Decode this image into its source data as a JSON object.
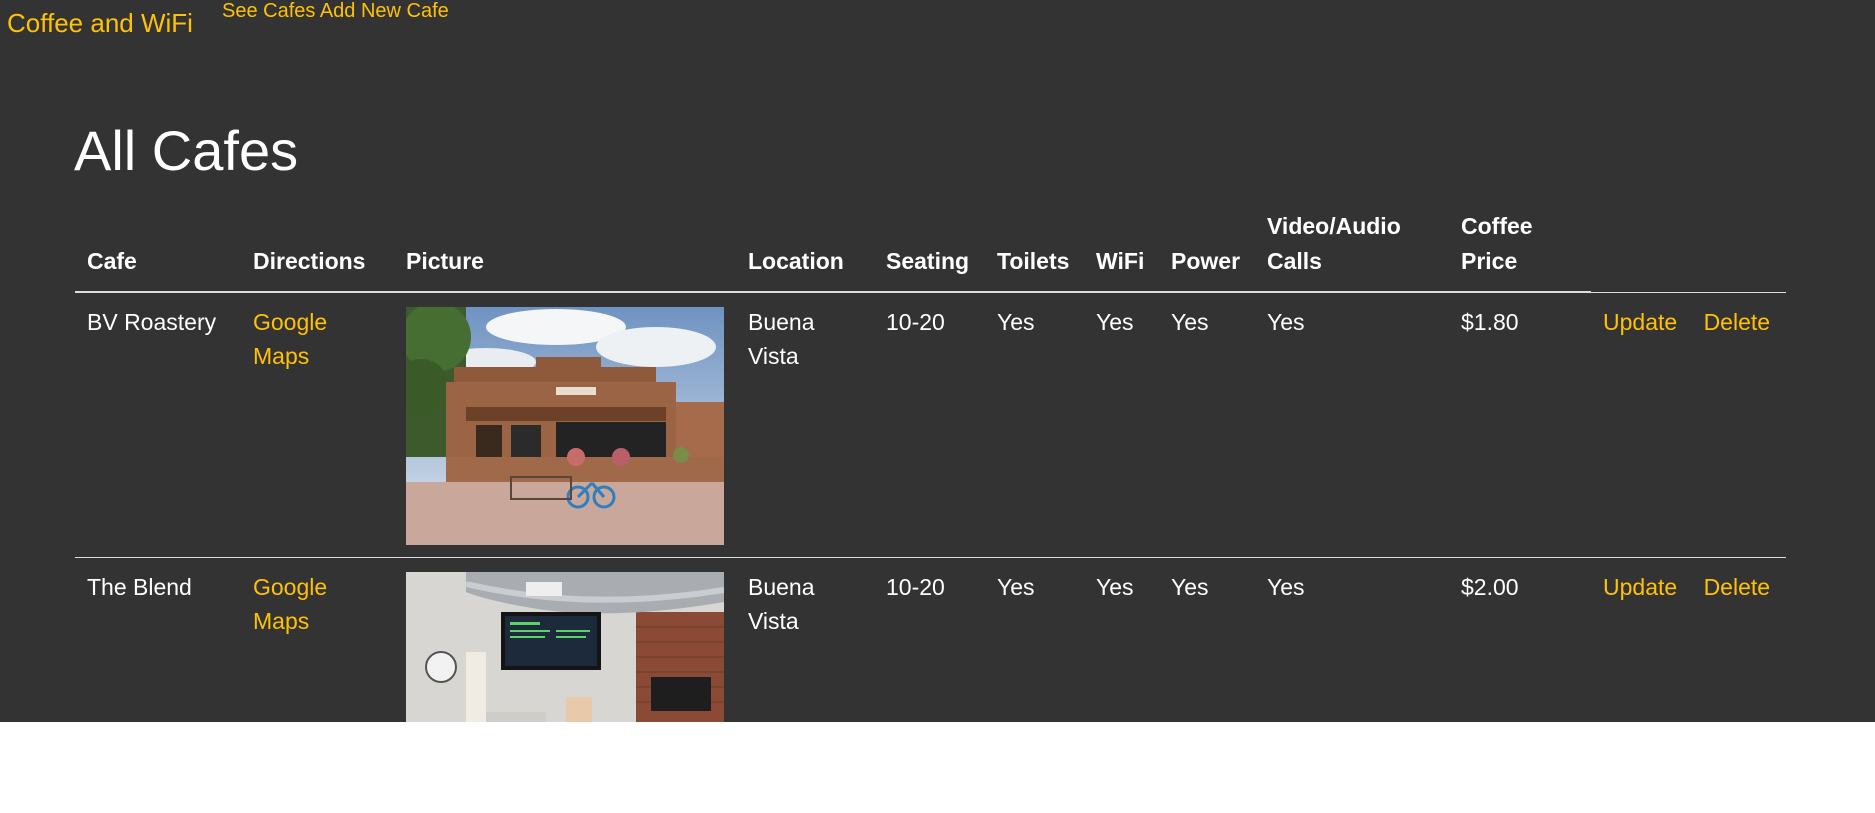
{
  "navbar": {
    "brand": "Coffee and WiFi",
    "links": [
      "See Cafes",
      "Add New Cafe"
    ]
  },
  "page_title": "All Cafes",
  "table": {
    "headers": [
      "Cafe",
      "Directions",
      "Picture",
      "Location",
      "Seating",
      "Toilets",
      "WiFi",
      "Power",
      "Video/Audio Calls",
      "Coffee Price",
      ""
    ],
    "rows": [
      {
        "cafe": "BV Roastery",
        "directions": "Google Maps",
        "picture": "cafe-exterior-photo",
        "location": "Buena Vista",
        "seating": "10-20",
        "toilets": "Yes",
        "wifi": "Yes",
        "power": "Yes",
        "calls": "Yes",
        "price": "$1.80",
        "update": "Update",
        "delete": "Delete"
      },
      {
        "cafe": "The Blend",
        "directions": "Google Maps",
        "picture": "cafe-interior-photo",
        "location": "Buena Vista",
        "seating": "10-20",
        "toilets": "Yes",
        "wifi": "Yes",
        "power": "Yes",
        "calls": "Yes",
        "price": "$2.00",
        "update": "Update",
        "delete": "Delete"
      }
    ]
  },
  "colors": {
    "background": "#333333",
    "accent": "#ffc107",
    "text": "#ffffff"
  }
}
